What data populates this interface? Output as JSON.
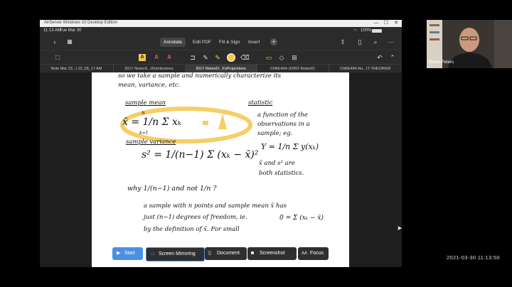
{
  "window": {
    "title": "AirServer Windows 10 Desktop Edition",
    "controls": [
      "—",
      "☐",
      "✕"
    ]
  },
  "status": {
    "time": "11:13 AM",
    "date": "Tue Mar 30",
    "battery": "100%"
  },
  "toolbar": {
    "tabs": [
      "Annotate",
      "Edit PDF",
      "Fill & Sign",
      "Insert"
    ],
    "active_tab": "Annotate",
    "add_icon": "+",
    "highlight_color": "#f3c64a"
  },
  "doc_tabs": [
    "Note Mar 23...t 10_58_17 AM",
    "2017-NotesS...tDistributions",
    "2017-NotesO...FsProjections",
    "ChBE494-JOINT-Notes01",
    "ChBE494-No...IT-THEOREM"
  ],
  "active_doc_tab": 2,
  "notes": {
    "line1": "so we take a sample and numerically characterize its",
    "line2": "mean, variance, etc.",
    "sample_mean_label": "sample mean",
    "mean_formula": "x̄ = 1/n Σ xₖ",
    "sum_bounds": {
      "top": "n",
      "bottom": "k=1"
    },
    "sample_variance_label": "sample variance",
    "variance_formula": "s² = 1/(n−1) Σ (xₖ − x̄)²",
    "statistic_label": "statistic",
    "statistic_def1": "a function of the",
    "statistic_def2": "observations in a",
    "statistic_def3": "sample; eg.",
    "y_formula": "Y = 1/n Σ y(xₖ)",
    "both_stat1": "x̄ and s² are",
    "both_stat2": "both statistics.",
    "question": "why 1/(n−1) and not 1/n ?",
    "answer1": "a sample with n points and sample mean x̄ has",
    "answer2": "just (n−1) degrees of freedom, ie.",
    "answer2_formula": "0 = Σ (xₖ − x̄)",
    "answer3": "by the definition of x̄. For small"
  },
  "overlay": {
    "start": "Start",
    "screen_mirroring": "Screen Mirroring",
    "document": "Document",
    "screenshot": "Screenshot",
    "focus": "Focus",
    "accent": "#4a90e2"
  },
  "webcam": {
    "name": "Baron Peters"
  },
  "clock": "2021-03-30  11:13:50"
}
